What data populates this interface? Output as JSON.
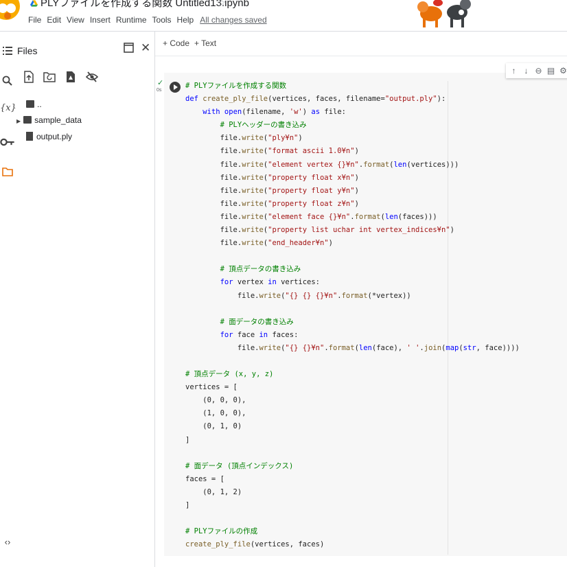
{
  "header": {
    "notebook_title": "PLYファイルを作成する関数 Untitled13.ipynb",
    "menu": [
      "File",
      "Edit",
      "View",
      "Insert",
      "Runtime",
      "Tools",
      "Help"
    ],
    "save_status": "All changes saved"
  },
  "toolbar": {
    "add_code": "+ Code",
    "add_text": "+ Text"
  },
  "files_panel": {
    "title": "Files",
    "tree": [
      {
        "name": "..",
        "type": "parent-folder"
      },
      {
        "name": "sample_data",
        "type": "folder"
      },
      {
        "name": "output.ply",
        "type": "file"
      }
    ]
  },
  "cell": {
    "status_check": "✓",
    "exec_time": "0s",
    "code_lines": [
      "# PLYファイルを作成する関数",
      "def create_ply_file(vertices, faces, filename=\"output.ply\"):",
      "    with open(filename, 'w') as file:",
      "        # PLYヘッダーの書き込み",
      "        file.write(\"ply¥n\")",
      "        file.write(\"format ascii 1.0¥n\")",
      "        file.write(\"element vertex {}¥n\".format(len(vertices)))",
      "        file.write(\"property float x¥n\")",
      "        file.write(\"property float y¥n\")",
      "        file.write(\"property float z¥n\")",
      "        file.write(\"element face {}¥n\".format(len(faces)))",
      "        file.write(\"property list uchar int vertex_indices¥n\")",
      "        file.write(\"end_header¥n\")",
      "",
      "        # 頂点データの書き込み",
      "        for vertex in vertices:",
      "            file.write(\"{} {} {}¥n\".format(*vertex))",
      "",
      "        # 面データの書き込み",
      "        for face in faces:",
      "            file.write(\"{} {}¥n\".format(len(face), ' '.join(map(str, face))))",
      "",
      "# 頂点データ (x, y, z)",
      "vertices = [",
      "    (0, 0, 0),",
      "    (1, 0, 0),",
      "    (0, 1, 0)",
      "]",
      "",
      "# 面データ (頂点インデックス)",
      "faces = [",
      "    (0, 1, 2)",
      "]",
      "",
      "# PLYファイルの作成",
      "create_ply_file(vertices, faces)"
    ]
  },
  "icons": {
    "rail": [
      "toc-icon",
      "search-icon",
      "variables-icon",
      "key-icon",
      "folder-icon",
      "code-snippets-icon"
    ],
    "files_toolbar": [
      "upload-icon",
      "refresh-icon",
      "mount-drive-icon",
      "hide-icon"
    ],
    "cell_toolbar": [
      "move-up-icon",
      "move-down-icon",
      "link-icon",
      "comment-icon",
      "settings-icon"
    ]
  },
  "colors": {
    "comment": "#008000",
    "keyword": "#0000ff",
    "string": "#a31515",
    "check": "#1e8e3e"
  }
}
